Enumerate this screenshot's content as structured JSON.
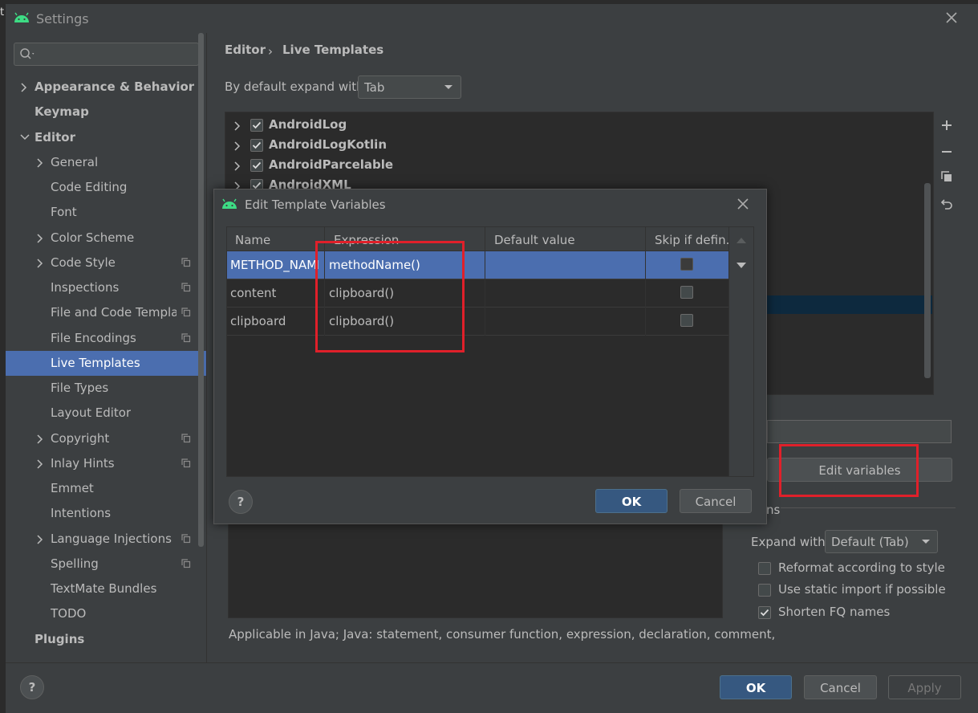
{
  "window": {
    "title": "Settings"
  },
  "edge_char": "t",
  "sidebar": {
    "search_placeholder": "",
    "items": [
      {
        "label": "Appearance & Behavior",
        "bold": true,
        "arrow": "right",
        "indent": 0
      },
      {
        "label": "Keymap",
        "bold": true,
        "arrow": "",
        "indent": 0
      },
      {
        "label": "Editor",
        "bold": true,
        "arrow": "down",
        "indent": 0
      },
      {
        "label": "General",
        "bold": false,
        "arrow": "right",
        "indent": 1
      },
      {
        "label": "Code Editing",
        "bold": false,
        "arrow": "",
        "indent": 1
      },
      {
        "label": "Font",
        "bold": false,
        "arrow": "",
        "indent": 1
      },
      {
        "label": "Color Scheme",
        "bold": false,
        "arrow": "right",
        "indent": 1
      },
      {
        "label": "Code Style",
        "bold": false,
        "arrow": "right",
        "indent": 1,
        "copy": true
      },
      {
        "label": "Inspections",
        "bold": false,
        "arrow": "",
        "indent": 1,
        "copy": true
      },
      {
        "label": "File and Code Templates",
        "bold": false,
        "arrow": "",
        "indent": 1,
        "copy": true
      },
      {
        "label": "File Encodings",
        "bold": false,
        "arrow": "",
        "indent": 1,
        "copy": true
      },
      {
        "label": "Live Templates",
        "bold": false,
        "arrow": "",
        "indent": 1,
        "selected": true
      },
      {
        "label": "File Types",
        "bold": false,
        "arrow": "",
        "indent": 1
      },
      {
        "label": "Layout Editor",
        "bold": false,
        "arrow": "",
        "indent": 1
      },
      {
        "label": "Copyright",
        "bold": false,
        "arrow": "right",
        "indent": 1,
        "copy": true
      },
      {
        "label": "Inlay Hints",
        "bold": false,
        "arrow": "right",
        "indent": 1,
        "copy": true
      },
      {
        "label": "Emmet",
        "bold": false,
        "arrow": "",
        "indent": 1
      },
      {
        "label": "Intentions",
        "bold": false,
        "arrow": "",
        "indent": 1
      },
      {
        "label": "Language Injections",
        "bold": false,
        "arrow": "right",
        "indent": 1,
        "copy": true
      },
      {
        "label": "Spelling",
        "bold": false,
        "arrow": "",
        "indent": 1,
        "copy": true
      },
      {
        "label": "TextMate Bundles",
        "bold": false,
        "arrow": "",
        "indent": 1
      },
      {
        "label": "TODO",
        "bold": false,
        "arrow": "",
        "indent": 1
      },
      {
        "label": "Plugins",
        "bold": true,
        "arrow": "",
        "indent": 0
      }
    ]
  },
  "breadcrumb": {
    "editor": "Editor",
    "separator": "›",
    "current": "Live Templates"
  },
  "expand_default": {
    "label": "By default expand with",
    "value": "Tab"
  },
  "template_groups": [
    {
      "label": "AndroidLog",
      "checked": true
    },
    {
      "label": "AndroidLogKotlin",
      "checked": true
    },
    {
      "label": "AndroidParcelable",
      "checked": true
    },
    {
      "label": "AndroidXML",
      "checked": true
    }
  ],
  "edit_variables_button": "Edit variables",
  "options_fragment": "ns",
  "expand_with": {
    "label": "Expand with",
    "value": "Default (Tab)"
  },
  "options": [
    {
      "label": "Reformat according to style",
      "checked": false
    },
    {
      "label": "Use static import if possible",
      "checked": false
    },
    {
      "label": "Shorten FQ names",
      "checked": true
    }
  ],
  "applicable_text": "Applicable in Java; Java: statement, consumer function, expression, declaration, comment,",
  "bottom_buttons": {
    "help": "?",
    "ok": "OK",
    "cancel": "Cancel",
    "apply": "Apply"
  },
  "dialog": {
    "title": "Edit Template Variables",
    "columns": [
      "Name",
      "Expression",
      "Default value",
      "Skip if defin..."
    ],
    "rows": [
      {
        "name": "METHOD_NAME",
        "expression": "methodName()",
        "default": "",
        "skip": false,
        "selected": true
      },
      {
        "name": "content",
        "expression": "clipboard()",
        "default": "",
        "skip": false
      },
      {
        "name": "clipboard",
        "expression": "clipboard()",
        "default": "",
        "skip": false
      }
    ],
    "help": "?",
    "ok": "OK",
    "cancel": "Cancel"
  },
  "colors": {
    "selection": "#4b6eaf",
    "primary_button": "#365880",
    "highlight_box": "#e0202a",
    "android_green": "#3ddc84"
  }
}
